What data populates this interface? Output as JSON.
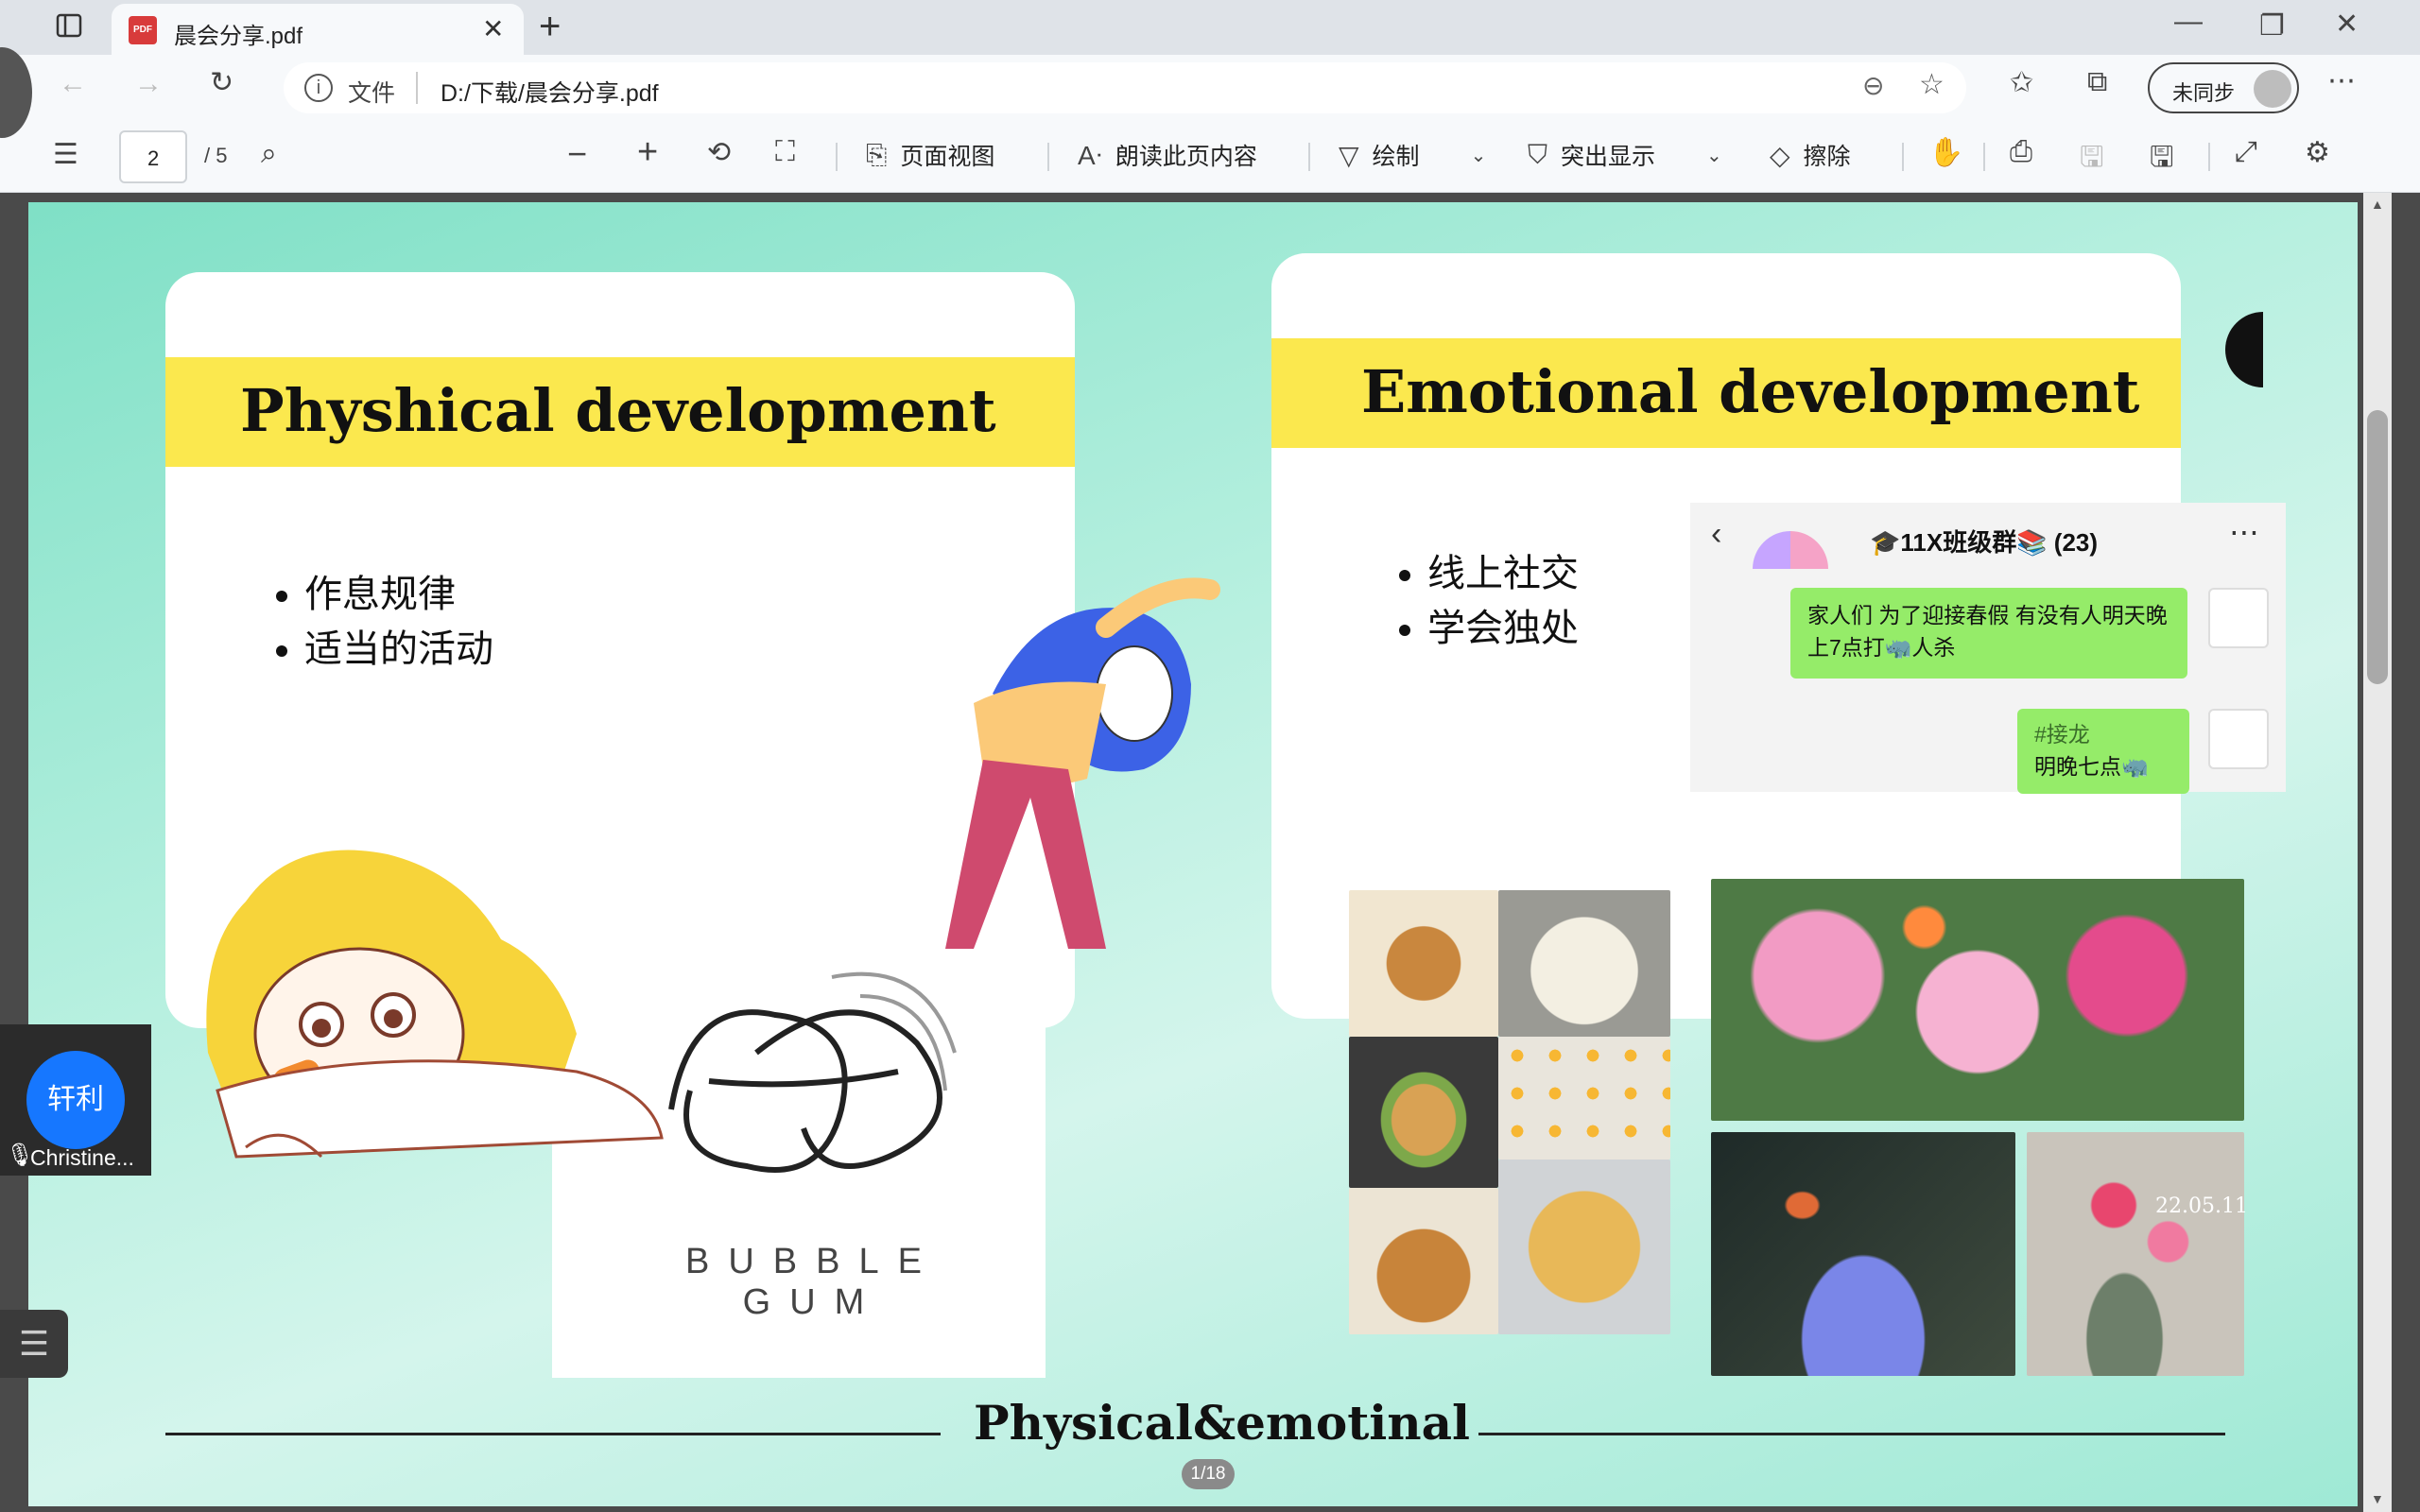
{
  "browser": {
    "tab_title": "晨会分享.pdf",
    "tab_icon_text": "PDF",
    "address_label": "文件",
    "address_path": "D:/下载/晨会分享.pdf",
    "profile_label": "未同步"
  },
  "pdf_toolbar": {
    "page_current": "2",
    "page_total": "/ 5",
    "page_view_label": "页面视图",
    "read_aloud_label": "朗读此页内容",
    "draw_label": "绘制",
    "highlight_label": "突出显示",
    "erase_label": "擦除"
  },
  "slide": {
    "left_card": {
      "title": "Physhical development",
      "bullets": [
        "作息规律",
        "适当的活动"
      ],
      "bubble_gum_text": "BUBBLE GUM"
    },
    "right_card": {
      "title": "Emotional development",
      "bullets": [
        "线上社交",
        "学会独处"
      ],
      "chat": {
        "group_name": "🎓11X班级群📚 (23)",
        "msg1": "家人们 为了迎接春假 有没有人明天晚上7点打🦏人杀",
        "msg2_tag": "#接龙",
        "msg2_text": "明晚七点🦏"
      },
      "photo_date": "22.05.11"
    },
    "footer_title": "Physical&emotinal",
    "page_indicator": "1/18"
  },
  "meeting_overlay": {
    "avatar_text": "轩利",
    "participant_name": "Christine..."
  },
  "colors": {
    "accent_yellow": "#fbe84e",
    "slide_green": "#9fe9d5",
    "avatar_blue": "#1677ff"
  }
}
